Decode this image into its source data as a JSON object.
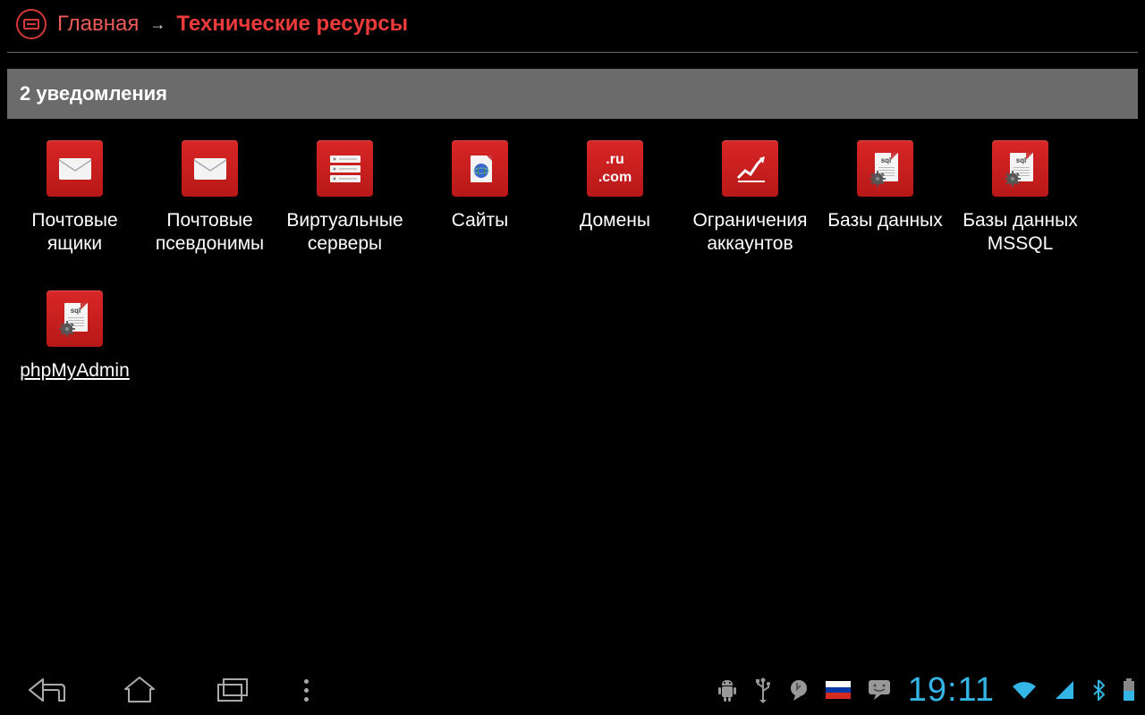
{
  "breadcrumb": {
    "home": "Главная",
    "arrow": "→",
    "current": "Технические ресурсы"
  },
  "notifications": {
    "text": "2 уведомления"
  },
  "tiles": [
    {
      "label": "Почтовые ящики",
      "icon": "mail"
    },
    {
      "label": "Почтовые псевдонимы",
      "icon": "mail"
    },
    {
      "label": "Виртуальные серверы",
      "icon": "servers"
    },
    {
      "label": "Сайты",
      "icon": "globe"
    },
    {
      "label": "Домены",
      "icon": "domains"
    },
    {
      "label": "Ограничения аккаунтов",
      "icon": "chart"
    },
    {
      "label": "Базы данных",
      "icon": "sql"
    },
    {
      "label": "Базы данных MSSQL",
      "icon": "sql"
    },
    {
      "label": "phpMyAdmin",
      "icon": "sql",
      "underline": true
    }
  ],
  "domains_icon": {
    "line1": ".ru",
    "line2": ".com"
  },
  "status": {
    "time": "19:11"
  }
}
